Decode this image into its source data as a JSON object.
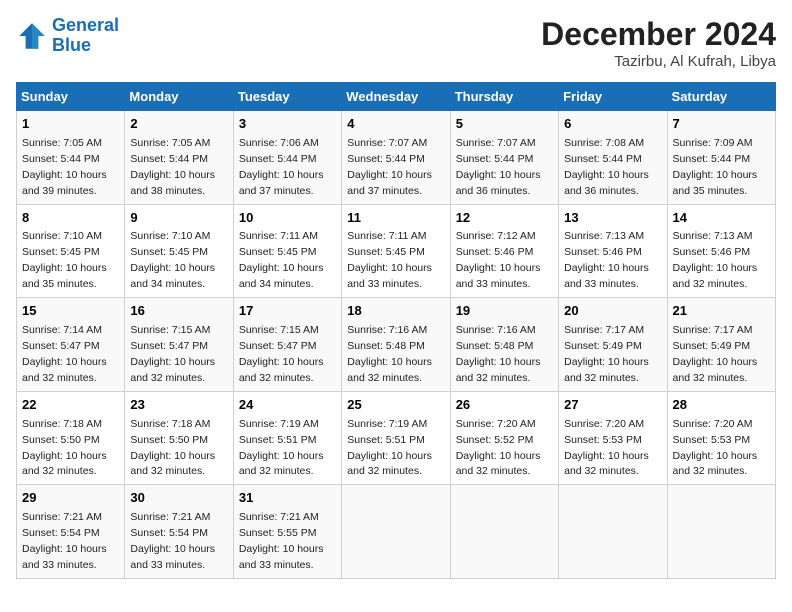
{
  "logo": {
    "line1": "General",
    "line2": "Blue"
  },
  "title": "December 2024",
  "location": "Tazirbu, Al Kufrah, Libya",
  "days_of_week": [
    "Sunday",
    "Monday",
    "Tuesday",
    "Wednesday",
    "Thursday",
    "Friday",
    "Saturday"
  ],
  "weeks": [
    [
      {
        "day": 1,
        "sunrise": "7:05 AM",
        "sunset": "5:44 PM",
        "daylight": "10 hours and 39 minutes."
      },
      {
        "day": 2,
        "sunrise": "7:05 AM",
        "sunset": "5:44 PM",
        "daylight": "10 hours and 38 minutes."
      },
      {
        "day": 3,
        "sunrise": "7:06 AM",
        "sunset": "5:44 PM",
        "daylight": "10 hours and 37 minutes."
      },
      {
        "day": 4,
        "sunrise": "7:07 AM",
        "sunset": "5:44 PM",
        "daylight": "10 hours and 37 minutes."
      },
      {
        "day": 5,
        "sunrise": "7:07 AM",
        "sunset": "5:44 PM",
        "daylight": "10 hours and 36 minutes."
      },
      {
        "day": 6,
        "sunrise": "7:08 AM",
        "sunset": "5:44 PM",
        "daylight": "10 hours and 36 minutes."
      },
      {
        "day": 7,
        "sunrise": "7:09 AM",
        "sunset": "5:44 PM",
        "daylight": "10 hours and 35 minutes."
      }
    ],
    [
      {
        "day": 8,
        "sunrise": "7:10 AM",
        "sunset": "5:45 PM",
        "daylight": "10 hours and 35 minutes."
      },
      {
        "day": 9,
        "sunrise": "7:10 AM",
        "sunset": "5:45 PM",
        "daylight": "10 hours and 34 minutes."
      },
      {
        "day": 10,
        "sunrise": "7:11 AM",
        "sunset": "5:45 PM",
        "daylight": "10 hours and 34 minutes."
      },
      {
        "day": 11,
        "sunrise": "7:11 AM",
        "sunset": "5:45 PM",
        "daylight": "10 hours and 33 minutes."
      },
      {
        "day": 12,
        "sunrise": "7:12 AM",
        "sunset": "5:46 PM",
        "daylight": "10 hours and 33 minutes."
      },
      {
        "day": 13,
        "sunrise": "7:13 AM",
        "sunset": "5:46 PM",
        "daylight": "10 hours and 33 minutes."
      },
      {
        "day": 14,
        "sunrise": "7:13 AM",
        "sunset": "5:46 PM",
        "daylight": "10 hours and 32 minutes."
      }
    ],
    [
      {
        "day": 15,
        "sunrise": "7:14 AM",
        "sunset": "5:47 PM",
        "daylight": "10 hours and 32 minutes."
      },
      {
        "day": 16,
        "sunrise": "7:15 AM",
        "sunset": "5:47 PM",
        "daylight": "10 hours and 32 minutes."
      },
      {
        "day": 17,
        "sunrise": "7:15 AM",
        "sunset": "5:47 PM",
        "daylight": "10 hours and 32 minutes."
      },
      {
        "day": 18,
        "sunrise": "7:16 AM",
        "sunset": "5:48 PM",
        "daylight": "10 hours and 32 minutes."
      },
      {
        "day": 19,
        "sunrise": "7:16 AM",
        "sunset": "5:48 PM",
        "daylight": "10 hours and 32 minutes."
      },
      {
        "day": 20,
        "sunrise": "7:17 AM",
        "sunset": "5:49 PM",
        "daylight": "10 hours and 32 minutes."
      },
      {
        "day": 21,
        "sunrise": "7:17 AM",
        "sunset": "5:49 PM",
        "daylight": "10 hours and 32 minutes."
      }
    ],
    [
      {
        "day": 22,
        "sunrise": "7:18 AM",
        "sunset": "5:50 PM",
        "daylight": "10 hours and 32 minutes."
      },
      {
        "day": 23,
        "sunrise": "7:18 AM",
        "sunset": "5:50 PM",
        "daylight": "10 hours and 32 minutes."
      },
      {
        "day": 24,
        "sunrise": "7:19 AM",
        "sunset": "5:51 PM",
        "daylight": "10 hours and 32 minutes."
      },
      {
        "day": 25,
        "sunrise": "7:19 AM",
        "sunset": "5:51 PM",
        "daylight": "10 hours and 32 minutes."
      },
      {
        "day": 26,
        "sunrise": "7:20 AM",
        "sunset": "5:52 PM",
        "daylight": "10 hours and 32 minutes."
      },
      {
        "day": 27,
        "sunrise": "7:20 AM",
        "sunset": "5:53 PM",
        "daylight": "10 hours and 32 minutes."
      },
      {
        "day": 28,
        "sunrise": "7:20 AM",
        "sunset": "5:53 PM",
        "daylight": "10 hours and 32 minutes."
      }
    ],
    [
      {
        "day": 29,
        "sunrise": "7:21 AM",
        "sunset": "5:54 PM",
        "daylight": "10 hours and 33 minutes."
      },
      {
        "day": 30,
        "sunrise": "7:21 AM",
        "sunset": "5:54 PM",
        "daylight": "10 hours and 33 minutes."
      },
      {
        "day": 31,
        "sunrise": "7:21 AM",
        "sunset": "5:55 PM",
        "daylight": "10 hours and 33 minutes."
      },
      null,
      null,
      null,
      null
    ]
  ]
}
